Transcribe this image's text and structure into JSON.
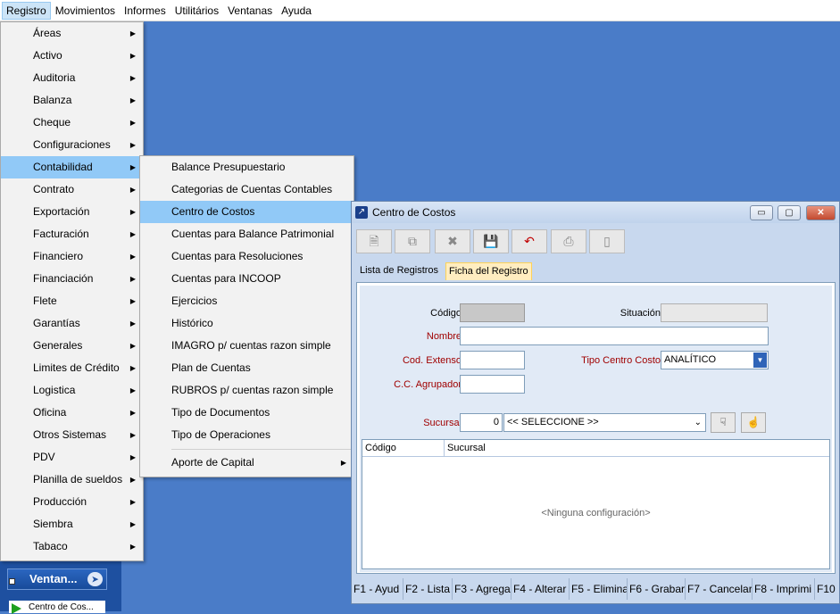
{
  "menubar": {
    "items": [
      "Registro",
      "Movimientos",
      "Informes",
      "Utilitários",
      "Ventanas",
      "Ayuda"
    ]
  },
  "registro_menu": {
    "items": [
      "Áreas",
      "Activo",
      "Auditoria",
      "Balanza",
      "Cheque",
      "Configuraciones",
      "Contabilidad",
      "Contrato",
      "Exportación",
      "Facturación",
      "Financiero",
      "Financiación",
      "Flete",
      "Garantías",
      "Generales",
      "Limites de Crédito",
      "Logistica",
      "Oficina",
      "Otros Sistemas",
      "PDV",
      "Planilla de sueldos",
      "Producción",
      "Siembra",
      "Tabaco"
    ],
    "highlighted": "Contabilidad"
  },
  "contabilidad_menu": {
    "items": [
      "Balance Presupuestario",
      "Categorias de Cuentas Contables",
      "Centro de Costos",
      "Cuentas para Balance Patrimonial",
      "Cuentas para Resoluciones",
      "Cuentas para INCOOP",
      "Ejercicios",
      "Histórico",
      "IMAGRO p/ cuentas razon simple",
      "Plan de Cuentas",
      "RUBROS p/ cuentas razon simple",
      "Tipo de Documentos",
      "Tipo de Operaciones"
    ],
    "last_item": "Aporte de Capital",
    "highlighted": "Centro de Costos"
  },
  "side_panel": {
    "title": "Ventan...",
    "item": "Centro de Cos..."
  },
  "window": {
    "title": "Centro de Costos",
    "controls": {
      "minimize": "▭",
      "restore": "▢",
      "close": "✕"
    },
    "tabs": [
      "Lista de Registros",
      "Ficha del Registro"
    ],
    "form": {
      "codigo_label": "Código",
      "situacion_label": "Situación",
      "nombre_label": "Nombre",
      "cod_extenso_label": "Cod. Extenso",
      "tipo_label": "Tipo Centro Costo",
      "tipo_value": "ANALÍTICO",
      "cc_agrupador_label": "C.C. Agrupador",
      "sucursal_label": "Sucursal",
      "sucursal_code": "0",
      "sucursal_select": "<< SELECCIONE >>"
    },
    "grid": {
      "columns": [
        "Código",
        "Sucursal"
      ],
      "empty_text": "<Ninguna configuración>"
    },
    "fkeys": [
      "F1 - Ayud",
      "F2 - Lista",
      "F3 - Agrega",
      "F4 - Alterar",
      "F5 - Elimina",
      "F6 - Grabar",
      "F7 - Cancelar",
      "F8 - Imprimi",
      "F10"
    ]
  },
  "colors": {
    "desktop": "#4a7cc8",
    "menu_highlight": "#91c9f7",
    "tab_active": "#ffedc0",
    "label_required": "#a00000"
  },
  "icons": [
    "new-icon",
    "copy-icon",
    "delete-icon",
    "save-icon",
    "undo-icon",
    "print-icon",
    "exit-icon",
    "hand-down-icon",
    "hand-up-icon",
    "chevron-right-icon"
  ]
}
